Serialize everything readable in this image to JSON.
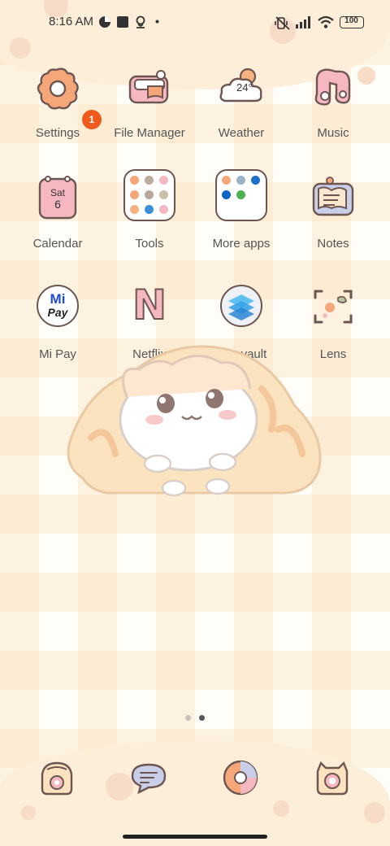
{
  "status_bar": {
    "time": "8:16 AM",
    "battery": "100"
  },
  "apps": [
    {
      "label": "Settings",
      "icon": "settings-icon",
      "badge": "1"
    },
    {
      "label": "File Manager",
      "icon": "file-manager-icon"
    },
    {
      "label": "Weather",
      "icon": "weather-icon",
      "temperature": "24°"
    },
    {
      "label": "Music",
      "icon": "music-icon"
    },
    {
      "label": "Calendar",
      "icon": "calendar-icon",
      "day": "Sat",
      "date": "6"
    },
    {
      "label": "Tools",
      "icon": "tools-folder"
    },
    {
      "label": "More apps",
      "icon": "more-apps-folder"
    },
    {
      "label": "Notes",
      "icon": "notes-icon"
    },
    {
      "label": "Mi Pay",
      "icon": "mi-pay-icon",
      "logo_mi": "Mi",
      "logo_pay": "Pay"
    },
    {
      "label": "Netflix",
      "icon": "netflix-icon",
      "letter": "N"
    },
    {
      "label": "App vault",
      "icon": "app-vault-icon"
    },
    {
      "label": "Lens",
      "icon": "lens-icon"
    }
  ],
  "dock": [
    {
      "icon": "phone-icon"
    },
    {
      "icon": "messages-icon"
    },
    {
      "icon": "browser-icon"
    },
    {
      "icon": "camera-icon"
    }
  ],
  "page_indicator": {
    "pages": 2,
    "current": 2
  },
  "colors": {
    "accent": "#f05a1d",
    "outline": "#6d5652",
    "label": "#555555",
    "cream": "#fdeed9",
    "peach": "#f5b27e",
    "pink": "#f6b8c0"
  }
}
